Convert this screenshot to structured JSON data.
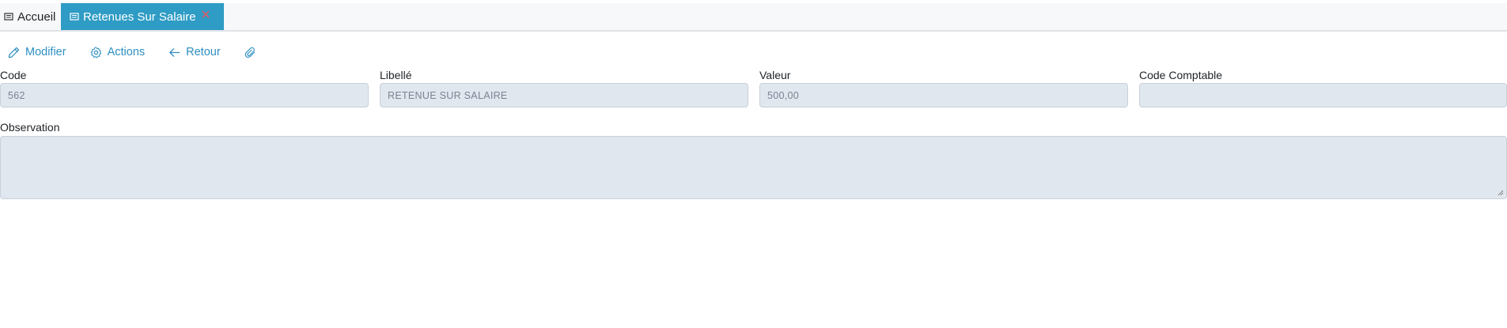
{
  "tabs": {
    "home_label": "Accueil",
    "active_label": "Retenues Sur Salaire",
    "close_glyph": "✕",
    "active_color": "#2e9cc4",
    "close_color": "#e05a6b"
  },
  "toolbar": {
    "modify_label": "Modifier",
    "actions_label": "Actions",
    "back_label": "Retour",
    "accent_color": "#2e8fc2"
  },
  "form": {
    "code": {
      "label": "Code",
      "value": "562"
    },
    "libelle": {
      "label": "Libellé",
      "value": "RETENUE SUR SALAIRE"
    },
    "valeur": {
      "label": "Valeur",
      "value": "500,00"
    },
    "code_comptable": {
      "label": "Code Comptable",
      "value": ""
    },
    "observation": {
      "label": "Observation",
      "value": ""
    }
  }
}
